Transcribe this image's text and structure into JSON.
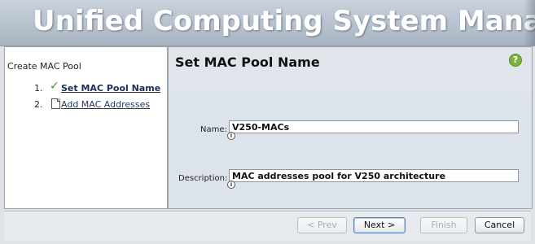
{
  "app": {
    "title": "Unified Computing System Manager"
  },
  "wizard": {
    "title": "Create MAC Pool",
    "steps": [
      {
        "number": "1.",
        "label": "Set MAC Pool Name",
        "state": "current"
      },
      {
        "number": "2.",
        "label": "Add MAC Addresses",
        "state": "pending"
      }
    ]
  },
  "page": {
    "title": "Set MAC Pool Name",
    "help_icon": "?"
  },
  "form": {
    "name": {
      "label": "Name:",
      "value": "V250-MACs"
    },
    "description": {
      "label": "Description:",
      "value": "MAC addresses pool for V250 architecture"
    }
  },
  "buttons": {
    "prev": "< Prev",
    "next": "Next >",
    "finish": "Finish",
    "cancel": "Cancel"
  },
  "colors": {
    "check": "#3a9a2a",
    "help": "#7cb33a",
    "link": "#1f3a6b"
  }
}
